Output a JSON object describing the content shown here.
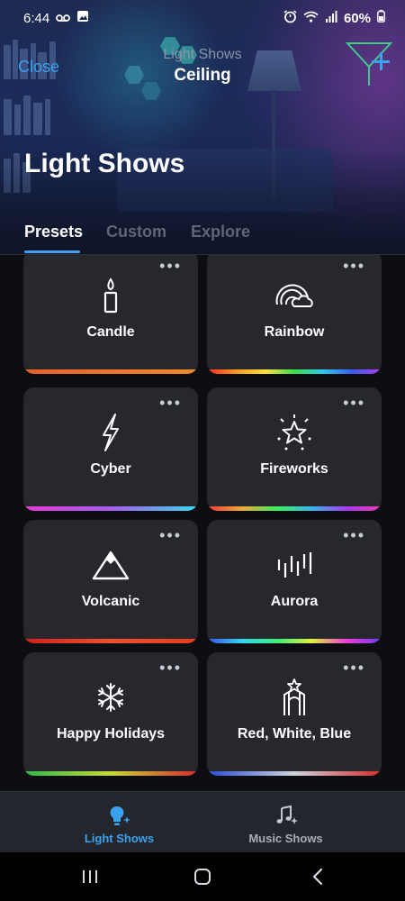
{
  "status_bar": {
    "time": "6:44",
    "battery": "60%"
  },
  "header": {
    "close_label": "Close",
    "subtitle": "Light Shows",
    "title": "Ceiling",
    "page_heading": "Light Shows"
  },
  "tabs": [
    {
      "label": "Presets",
      "active": true
    },
    {
      "label": "Custom",
      "active": false
    },
    {
      "label": "Explore",
      "active": false
    }
  ],
  "presets": [
    {
      "label": "Candle",
      "icon": "candle-icon",
      "colors": [
        "#e8602a",
        "#f08a30"
      ]
    },
    {
      "label": "Rainbow",
      "icon": "rainbow-icon",
      "colors": [
        "#ff2a2a",
        "#ff9a1f",
        "#ffe23a",
        "#38e04a",
        "#2ec8f0",
        "#3a5cf0",
        "#b23af0"
      ]
    },
    {
      "label": "Cyber",
      "icon": "lightning-icon",
      "colors": [
        "#e83ad8",
        "#a65cf0",
        "#3ad8f0"
      ]
    },
    {
      "label": "Fireworks",
      "icon": "fireworks-icon",
      "colors": [
        "#f03a3a",
        "#f0a83a",
        "#3af05a",
        "#3ab4f0",
        "#a83af0",
        "#f03ab4"
      ]
    },
    {
      "label": "Volcanic",
      "icon": "mountain-icon",
      "colors": [
        "#d41e1e",
        "#f0502a",
        "#e83a1e"
      ]
    },
    {
      "label": "Aurora",
      "icon": "aurora-icon",
      "colors": [
        "#3a4ef0",
        "#2ed8f0",
        "#3af07a",
        "#e0f03a",
        "#f03ad8",
        "#6a3af0"
      ]
    },
    {
      "label": "Happy Holidays",
      "icon": "snowflake-icon",
      "colors": [
        "#2eb84a",
        "#c8d83a",
        "#d42a2a"
      ]
    },
    {
      "label": "Red, White, Blue",
      "icon": "flag-monument-icon",
      "colors": [
        "#2a4ad4",
        "#cfd3dc",
        "#d42a2a"
      ]
    }
  ],
  "bottom_nav": [
    {
      "label": "Light Shows",
      "active": true,
      "icon": "bulb-sparkle-icon"
    },
    {
      "label": "Music Shows",
      "active": false,
      "icon": "music-note-icon"
    }
  ],
  "colors": {
    "accent": "#3aa2ee",
    "card": "#26282e",
    "background": "#0d0e11"
  }
}
